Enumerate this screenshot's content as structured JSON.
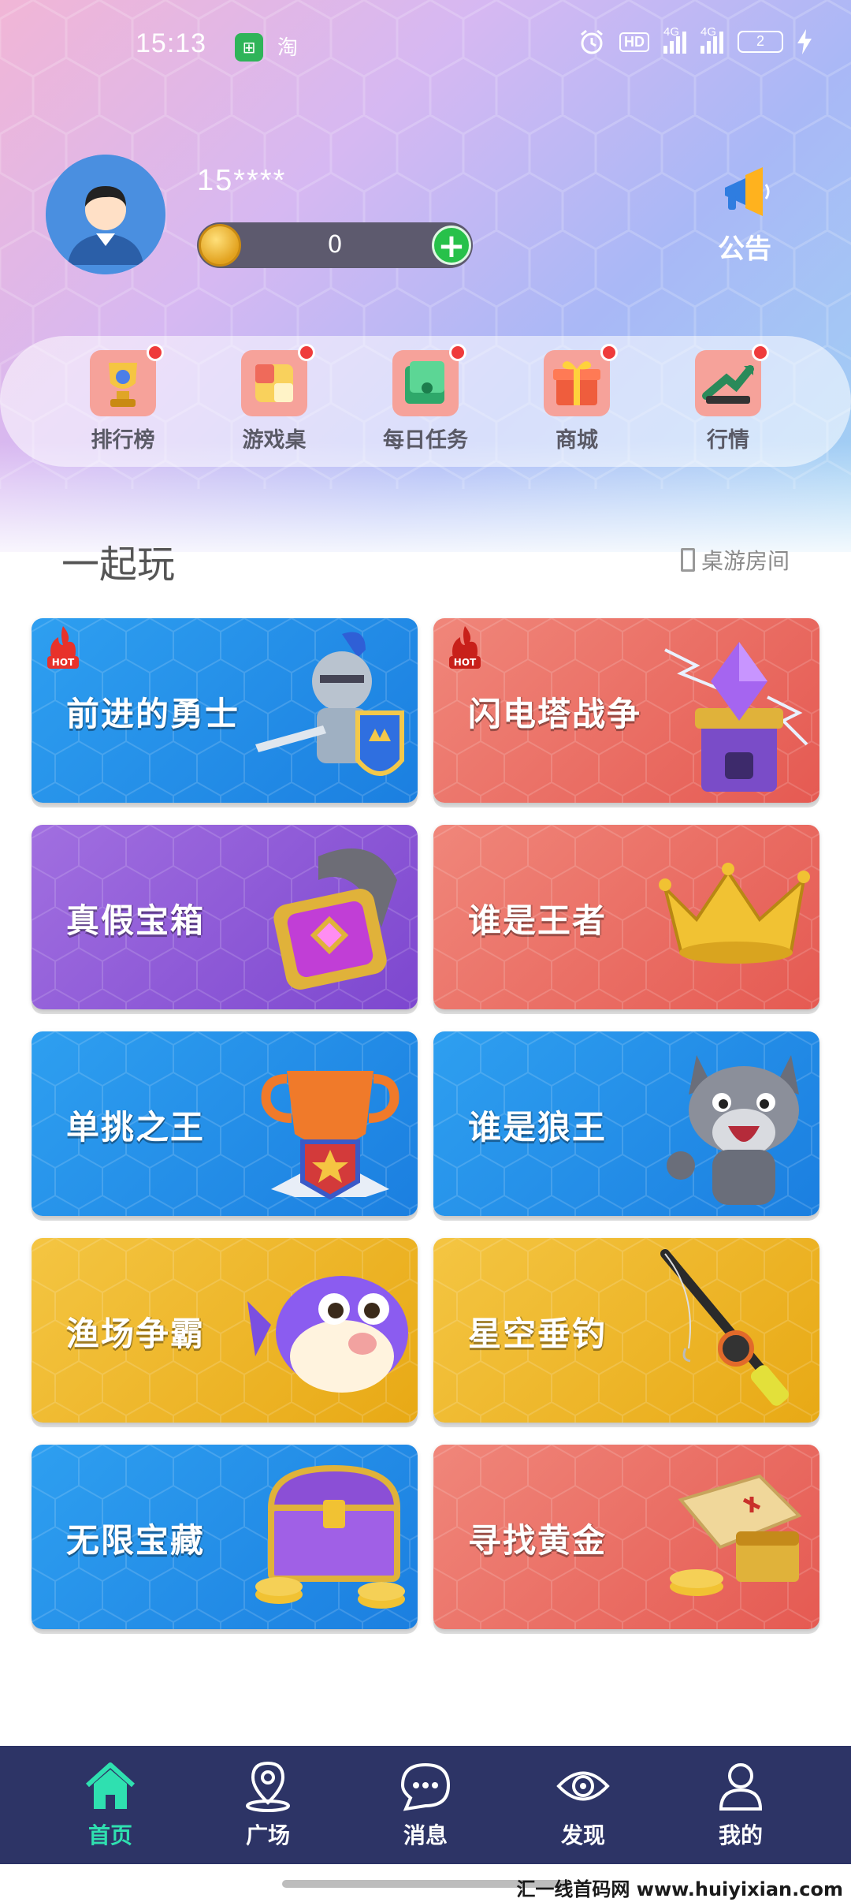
{
  "status_bar": {
    "time": "15:13",
    "app1_icon": "green-shopping-icon",
    "app2_label": "淘",
    "hd_label": "HD",
    "signal1_label": "4G",
    "signal2_label": "4G",
    "battery_level": "2"
  },
  "profile": {
    "username": "15****",
    "coin_value": "0",
    "add_label": "+",
    "notice_label": "公告"
  },
  "quick_menu": [
    {
      "label": "排行榜",
      "icon": "trophy-icon"
    },
    {
      "label": "游戏桌",
      "icon": "cube-icon"
    },
    {
      "label": "每日任务",
      "icon": "wallet-icon"
    },
    {
      "label": "商城",
      "icon": "gift-icon"
    },
    {
      "label": "行情",
      "icon": "chart-icon"
    }
  ],
  "section": {
    "title": "一起玩",
    "room_link": "桌游房间"
  },
  "games": [
    {
      "title": "前进的勇士",
      "theme": "blue",
      "hot": true,
      "hot_label": "HOT",
      "art": "knight-icon"
    },
    {
      "title": "闪电塔战争",
      "theme": "red",
      "hot": true,
      "hot_label": "HOT",
      "art": "crystal-tower-icon"
    },
    {
      "title": "真假宝箱",
      "theme": "purple",
      "hot": false,
      "art": "gem-chest-icon"
    },
    {
      "title": "谁是王者",
      "theme": "red",
      "hot": false,
      "art": "crown-icon"
    },
    {
      "title": "单挑之王",
      "theme": "blue",
      "hot": false,
      "art": "trophy-star-icon"
    },
    {
      "title": "谁是狼王",
      "theme": "blue",
      "hot": false,
      "art": "wolf-icon"
    },
    {
      "title": "渔场争霸",
      "theme": "yellow",
      "hot": false,
      "art": "puffer-fish-icon"
    },
    {
      "title": "星空垂钓",
      "theme": "yellow",
      "hot": false,
      "art": "fishing-rod-icon"
    },
    {
      "title": "无限宝藏",
      "theme": "blue",
      "hot": false,
      "art": "treasure-chest-icon"
    },
    {
      "title": "寻找黄金",
      "theme": "red",
      "hot": false,
      "art": "treasure-map-icon"
    }
  ],
  "bottom_nav": [
    {
      "label": "首页",
      "icon": "home-icon",
      "active": true
    },
    {
      "label": "广场",
      "icon": "location-pin-icon",
      "active": false
    },
    {
      "label": "消息",
      "icon": "chat-bubble-icon",
      "active": false
    },
    {
      "label": "发现",
      "icon": "eye-icon",
      "active": false
    },
    {
      "label": "我的",
      "icon": "user-icon",
      "active": false
    }
  ],
  "watermark": "汇一线首码网 www.huiyixian.com",
  "colors": {
    "card_blue": "#1b7fe0",
    "card_red": "#e55a52",
    "card_purple": "#7d47cf",
    "card_yellow": "#e8a915",
    "nav_bg": "#2d3466",
    "nav_active": "#2fe0b0",
    "badge_red": "#ef3b3b"
  }
}
